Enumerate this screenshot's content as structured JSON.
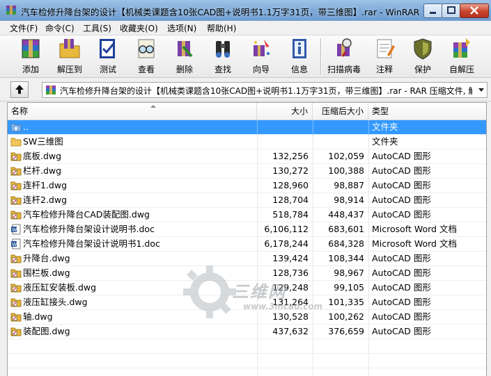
{
  "window": {
    "title": "汽车检修升降台架的设计【机械类课题含10张CAD图+说明书1.1万字31页，带三维图】.rar - WinRAR"
  },
  "menu": [
    "文件(F)",
    "命令(C)",
    "工具(S)",
    "收藏夹(O)",
    "选项(N)",
    "帮助(H)"
  ],
  "toolbar": {
    "add": "添加",
    "extract_to": "解压到",
    "test": "测试",
    "view": "查看",
    "delete": "删除",
    "find": "查找",
    "wizard": "向导",
    "info": "信息",
    "virus_scan": "扫描病毒",
    "comment": "注释",
    "protect": "保护",
    "sfx": "自解压"
  },
  "address": {
    "path": "汽车检修升降台架的设计【机械类课题含10张CAD图+说明书1.1万字31页，带三维图】.rar - RAR 压缩文件, 解包大小为 15,"
  },
  "columns": {
    "name": "名称",
    "size": "大小",
    "packed": "压缩后大小",
    "type": "类型"
  },
  "files": [
    {
      "name": "..",
      "size": "",
      "packed": "",
      "type": "文件夹",
      "icon": "folder-up-icon"
    },
    {
      "name": "SW三维图",
      "size": "",
      "packed": "",
      "type": "文件夹",
      "icon": "folder-icon"
    },
    {
      "name": "底板.dwg",
      "size": "132,256",
      "packed": "102,059",
      "type": "AutoCAD 图形",
      "icon": "dwg-icon"
    },
    {
      "name": "栏杆.dwg",
      "size": "130,272",
      "packed": "100,388",
      "type": "AutoCAD 图形",
      "icon": "dwg-icon"
    },
    {
      "name": "连杆1.dwg",
      "size": "128,960",
      "packed": "98,887",
      "type": "AutoCAD 图形",
      "icon": "dwg-icon"
    },
    {
      "name": "连杆2.dwg",
      "size": "128,704",
      "packed": "98,914",
      "type": "AutoCAD 图形",
      "icon": "dwg-icon"
    },
    {
      "name": "汽车检修升降台CAD装配图.dwg",
      "size": "518,784",
      "packed": "448,437",
      "type": "AutoCAD 图形",
      "icon": "dwg-icon"
    },
    {
      "name": "汽车检修升降台架设计说明书.doc",
      "size": "6,106,112",
      "packed": "683,601",
      "type": "Microsoft Word 文档",
      "icon": "doc-icon"
    },
    {
      "name": "汽车检修升降台架设计说明书1.doc",
      "size": "6,178,244",
      "packed": "684,328",
      "type": "Microsoft Word 文档",
      "icon": "doc-icon"
    },
    {
      "name": "升降台.dwg",
      "size": "139,424",
      "packed": "108,344",
      "type": "AutoCAD 图形",
      "icon": "dwg-icon"
    },
    {
      "name": "围栏板.dwg",
      "size": "128,736",
      "packed": "98,967",
      "type": "AutoCAD 图形",
      "icon": "dwg-icon"
    },
    {
      "name": "液压缸安装板.dwg",
      "size": "129,248",
      "packed": "99,105",
      "type": "AutoCAD 图形",
      "icon": "dwg-icon"
    },
    {
      "name": "液压缸接头.dwg",
      "size": "131,264",
      "packed": "101,335",
      "type": "AutoCAD 图形",
      "icon": "dwg-icon"
    },
    {
      "name": "轴.dwg",
      "size": "130,528",
      "packed": "100,262",
      "type": "AutoCAD 图形",
      "icon": "dwg-icon"
    },
    {
      "name": "装配图.dwg",
      "size": "437,632",
      "packed": "376,659",
      "type": "AutoCAD 图形",
      "icon": "dwg-icon"
    }
  ],
  "selected_row": 0,
  "watermark": {
    "text": "三维网",
    "url": "www.3mcad.com"
  },
  "colors": {
    "selection": "#3399ff",
    "titlebar": "#7aa7d6"
  }
}
